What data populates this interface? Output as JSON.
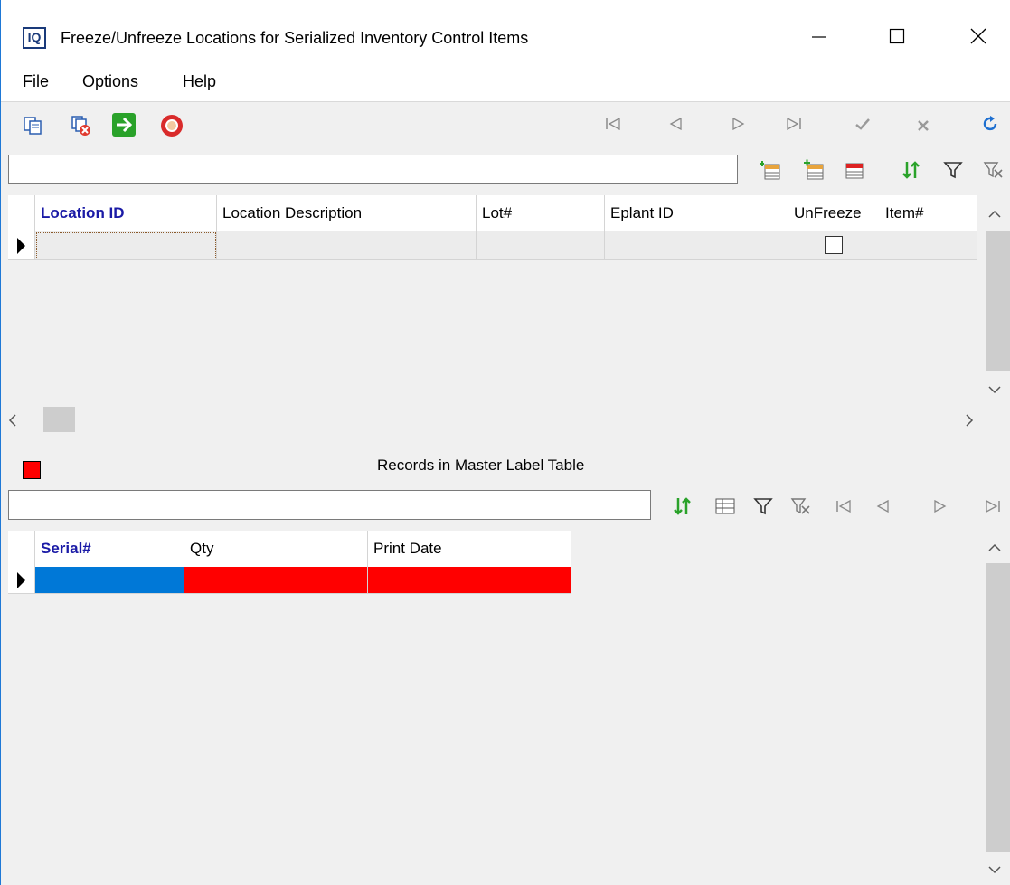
{
  "window": {
    "title": "Freeze/Unfreeze Locations for Serialized Inventory Control Items",
    "app_icon": "IQ"
  },
  "menu": {
    "file": "File",
    "options": "Options",
    "help": "Help"
  },
  "upper_grid": {
    "columns": [
      "Location ID",
      "Location Description",
      "Lot#",
      "Eplant ID",
      "UnFreeze",
      "Item#"
    ],
    "unfreeze_checked": false
  },
  "lower_section": {
    "title": "Records in Master Label Table",
    "indicator_color": "#ff0000",
    "columns": [
      "Serial#",
      "Qty",
      "Print Date"
    ]
  },
  "colors": {
    "accent_blue": "#0078d7",
    "header_blue_text": "#1a1aa6",
    "row_red": "#ff0000"
  }
}
